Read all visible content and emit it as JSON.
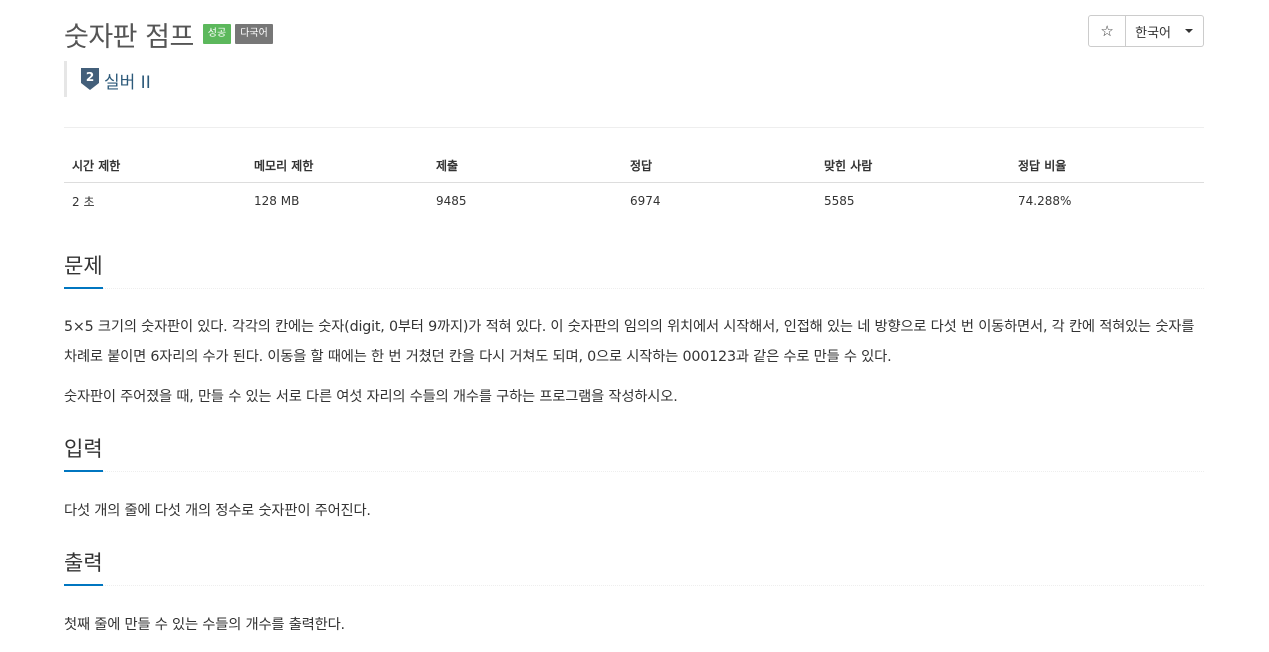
{
  "problem": {
    "title": "숫자판 점프",
    "badges": {
      "success": "성공",
      "multilang": "다국어"
    },
    "tier": {
      "number": "2",
      "label": "실버 II"
    }
  },
  "actions": {
    "star_symbol": "☆",
    "language": "한국어"
  },
  "info_table": {
    "headers": [
      "시간 제한",
      "메모리 제한",
      "제출",
      "정답",
      "맞힌 사람",
      "정답 비율"
    ],
    "values": [
      "2 초",
      "128 MB",
      "9485",
      "6974",
      "5585",
      "74.288%"
    ]
  },
  "sections": {
    "problem": {
      "heading": "문제",
      "paragraphs": [
        "5×5 크기의 숫자판이 있다. 각각의 칸에는 숫자(digit, 0부터 9까지)가 적혀 있다. 이 숫자판의 임의의 위치에서 시작해서, 인접해 있는 네 방향으로 다섯 번 이동하면서, 각 칸에 적혀있는 숫자를 차례로 붙이면 6자리의 수가 된다. 이동을 할 때에는 한 번 거쳤던 칸을 다시 거쳐도 되며, 0으로 시작하는 000123과 같은 수로 만들 수 있다.",
        "숫자판이 주어졌을 때, 만들 수 있는 서로 다른 여섯 자리의 수들의 개수를 구하는 프로그램을 작성하시오."
      ]
    },
    "input": {
      "heading": "입력",
      "text": "다섯 개의 줄에 다섯 개의 정수로 숫자판이 주어진다."
    },
    "output": {
      "heading": "출력",
      "text": "첫째 줄에 만들 수 있는 수들의 개수를 출력한다."
    }
  },
  "colors": {
    "success_badge": "#5cb85c",
    "multilang_badge": "#777777",
    "section_underline": "#0076c0",
    "tier_silver": "#435f7a"
  }
}
